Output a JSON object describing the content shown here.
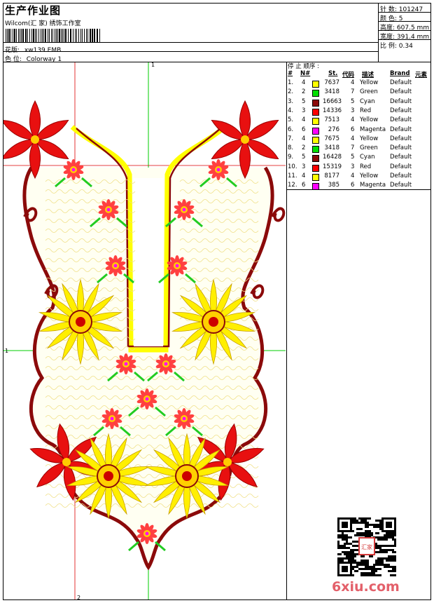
{
  "header": {
    "title": "生产作业图",
    "subtitle": "Wilcom(汇 家) 绣饰工作室",
    "design_label": "花版:",
    "design_value": "xw139.EMB",
    "colorway_label": "色 位:",
    "colorway_value": "Colorway 1"
  },
  "stats": {
    "stitches_label": "针 数:",
    "stitches_value": "101247",
    "colors_label": "颜 色:",
    "colors_value": "5",
    "height_label": "高度:",
    "height_value": "607.5 mm",
    "width_label": "宽度:",
    "width_value": "391.4 mm",
    "scale_label": "比 例:",
    "scale_value": "0.34"
  },
  "stop_sequence": {
    "title": "停 止 顺序 :",
    "columns": [
      "#",
      "N#",
      "St.",
      "代码",
      "描述",
      "Brand",
      "元素"
    ],
    "rows": [
      {
        "idx": "1.",
        "n": "4",
        "color": "#ffff00",
        "st": "7637",
        "code": "4",
        "desc": "Yellow",
        "brand": "Default"
      },
      {
        "idx": "2.",
        "n": "2",
        "color": "#00e000",
        "st": "3418",
        "code": "7",
        "desc": "Green",
        "brand": "Default"
      },
      {
        "idx": "3.",
        "n": "5",
        "color": "#8b0a0a",
        "st": "16663",
        "code": "5",
        "desc": "Cyan",
        "brand": "Default"
      },
      {
        "idx": "4.",
        "n": "3",
        "color": "#ff0000",
        "st": "14336",
        "code": "3",
        "desc": "Red",
        "brand": "Default"
      },
      {
        "idx": "5.",
        "n": "4",
        "color": "#ffff00",
        "st": "7513",
        "code": "4",
        "desc": "Yellow",
        "brand": "Default"
      },
      {
        "idx": "6.",
        "n": "6",
        "color": "#ff00ff",
        "st": "276",
        "code": "6",
        "desc": "Magenta",
        "brand": "Default"
      },
      {
        "idx": "7.",
        "n": "4",
        "color": "#ffff00",
        "st": "7675",
        "code": "4",
        "desc": "Yellow",
        "brand": "Default"
      },
      {
        "idx": "8.",
        "n": "2",
        "color": "#00e000",
        "st": "3418",
        "code": "7",
        "desc": "Green",
        "brand": "Default"
      },
      {
        "idx": "9.",
        "n": "5",
        "color": "#8b0a0a",
        "st": "16428",
        "code": "5",
        "desc": "Cyan",
        "brand": "Default"
      },
      {
        "idx": "10.",
        "n": "3",
        "color": "#ff0000",
        "st": "15319",
        "code": "3",
        "desc": "Red",
        "brand": "Default"
      },
      {
        "idx": "11.",
        "n": "4",
        "color": "#ffff00",
        "st": "8177",
        "code": "4",
        "desc": "Yellow",
        "brand": "Default"
      },
      {
        "idx": "12.",
        "n": "6",
        "color": "#ff00ff",
        "st": "385",
        "code": "6",
        "desc": "Magenta",
        "brand": "Default"
      }
    ]
  },
  "guides": {
    "top_marker": "1",
    "left_marker": "1",
    "bottom_marker": "2"
  },
  "qr": {
    "stamp_text": "汇家"
  },
  "watermark": "6xiu.com"
}
